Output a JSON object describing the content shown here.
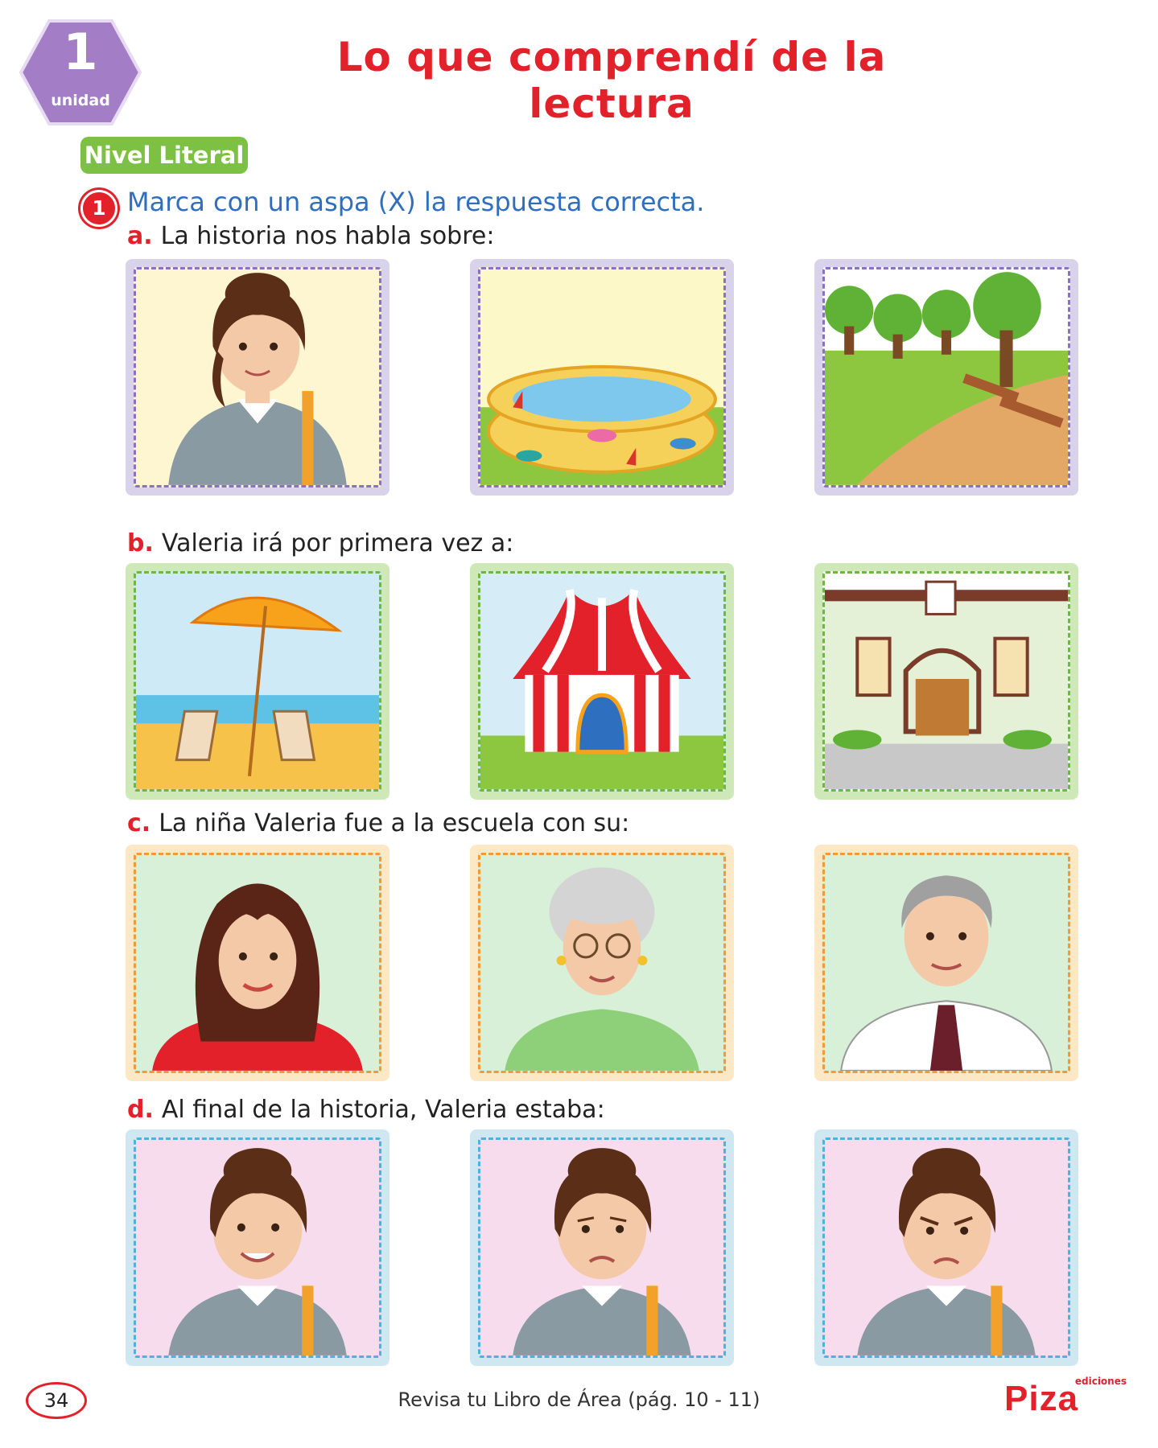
{
  "unit_badge": {
    "number": "1",
    "label": "unidad"
  },
  "title": "Lo que comprendí de la lectura",
  "level": "Nivel Literal",
  "question": {
    "number": "1",
    "instruction": "Marca con un aspa (X) la respuesta correcta."
  },
  "items": [
    {
      "letter": "a.",
      "text": "La historia nos habla sobre:",
      "options": [
        "girl-with-backpack",
        "inflatable-pool",
        "park-with-benches"
      ]
    },
    {
      "letter": "b.",
      "text": "Valeria irá por primera vez a:",
      "options": [
        "beach-umbrella",
        "circus-tent",
        "school-building"
      ]
    },
    {
      "letter": "c.",
      "text": "La niña Valeria fue a la escuela con su:",
      "options": [
        "young-woman",
        "grandmother",
        "grandfather"
      ]
    },
    {
      "letter": "d.",
      "text": "Al final de la historia, Valeria estaba:",
      "options": [
        "happy-girl",
        "sad-girl",
        "angry-girl"
      ]
    }
  ],
  "colors": {
    "accent_red": "#e2212b",
    "unit_purple": "#a47dc7",
    "level_green": "#7cc143",
    "instruction_blue": "#2f6fc0"
  },
  "footer": {
    "page_number": "34",
    "note": "Revisa tu Libro de Área (pág. 10 - 11)",
    "brand_small": "ediciones",
    "brand": "Piza"
  }
}
